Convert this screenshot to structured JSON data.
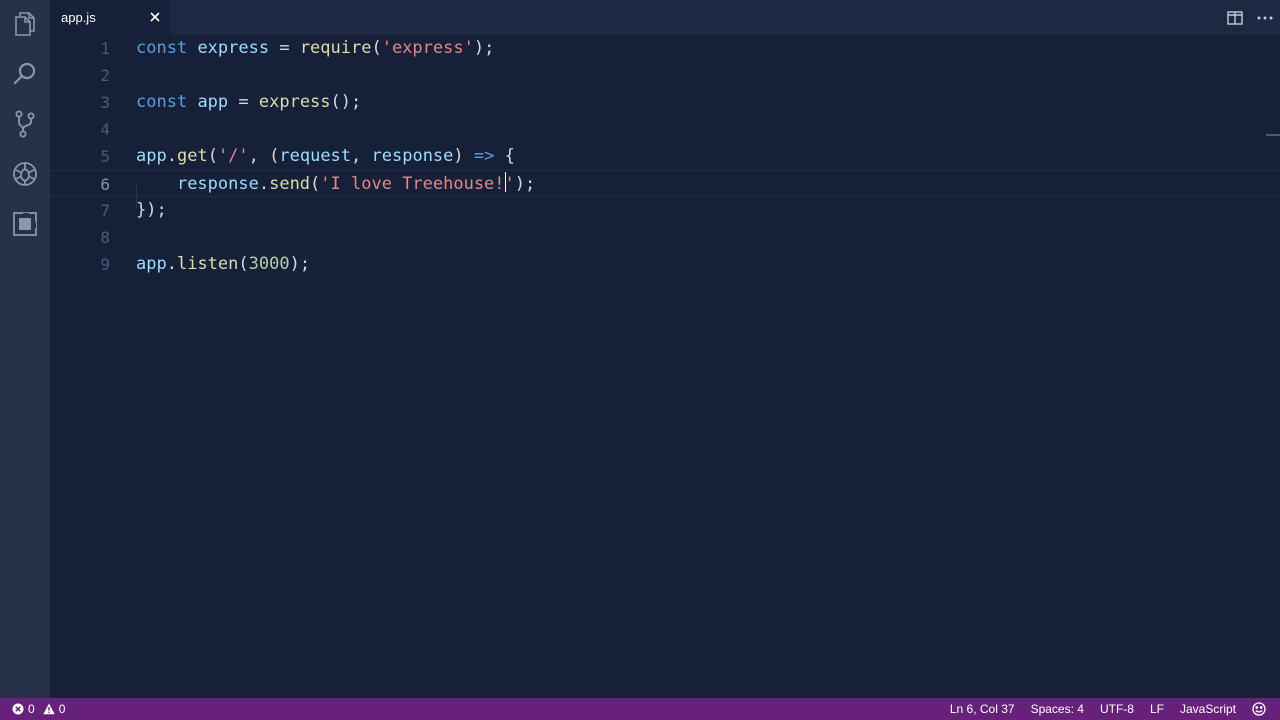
{
  "tab": {
    "filename": "app.js",
    "close_icon": "close-icon"
  },
  "tab_actions": [
    {
      "name": "split-editor-icon"
    },
    {
      "name": "more-actions-icon"
    }
  ],
  "activity_bar": [
    {
      "name": "explorer-icon"
    },
    {
      "name": "search-icon"
    },
    {
      "name": "source-control-icon"
    },
    {
      "name": "debug-icon"
    },
    {
      "name": "extensions-icon"
    }
  ],
  "editor": {
    "current_line": 6,
    "lines": [
      {
        "n": "1",
        "tokens": [
          [
            "kw",
            "const"
          ],
          [
            "punc",
            " "
          ],
          [
            "var",
            "express"
          ],
          [
            "punc",
            " = "
          ],
          [
            "fn",
            "require"
          ],
          [
            "punc",
            "("
          ],
          [
            "str",
            "'express'"
          ],
          [
            "punc",
            ");"
          ]
        ]
      },
      {
        "n": "2",
        "tokens": []
      },
      {
        "n": "3",
        "tokens": [
          [
            "kw",
            "const"
          ],
          [
            "punc",
            " "
          ],
          [
            "var",
            "app"
          ],
          [
            "punc",
            " = "
          ],
          [
            "fn",
            "express"
          ],
          [
            "punc",
            "();"
          ]
        ]
      },
      {
        "n": "4",
        "tokens": []
      },
      {
        "n": "5",
        "tokens": [
          [
            "var",
            "app"
          ],
          [
            "punc",
            "."
          ],
          [
            "fn",
            "get"
          ],
          [
            "punc",
            "("
          ],
          [
            "str",
            "'/'"
          ],
          [
            "punc",
            ", ("
          ],
          [
            "var",
            "request"
          ],
          [
            "punc",
            ", "
          ],
          [
            "var",
            "response"
          ],
          [
            "punc",
            ") "
          ],
          [
            "op",
            "=>"
          ],
          [
            "punc",
            " {"
          ]
        ]
      },
      {
        "n": "6",
        "tokens": [
          [
            "punc",
            "    "
          ],
          [
            "var",
            "response"
          ],
          [
            "punc",
            "."
          ],
          [
            "fn",
            "send"
          ],
          [
            "punc",
            "("
          ],
          [
            "str",
            "'I love Treehouse!"
          ],
          [
            "caret",
            ""
          ],
          [
            "str",
            "'"
          ],
          [
            "punc",
            ");"
          ]
        ]
      },
      {
        "n": "7",
        "tokens": [
          [
            "punc",
            "});"
          ]
        ]
      },
      {
        "n": "8",
        "tokens": []
      },
      {
        "n": "9",
        "tokens": [
          [
            "var",
            "app"
          ],
          [
            "punc",
            "."
          ],
          [
            "fn",
            "listen"
          ],
          [
            "punc",
            "("
          ],
          [
            "num",
            "3000"
          ],
          [
            "punc",
            ");"
          ]
        ]
      }
    ]
  },
  "status": {
    "errors": "0",
    "warnings": "0",
    "position": "Ln 6, Col 37",
    "spaces": "Spaces: 4",
    "encoding": "UTF-8",
    "eol": "LF",
    "language": "JavaScript",
    "feedback_icon": "smiley-icon"
  }
}
